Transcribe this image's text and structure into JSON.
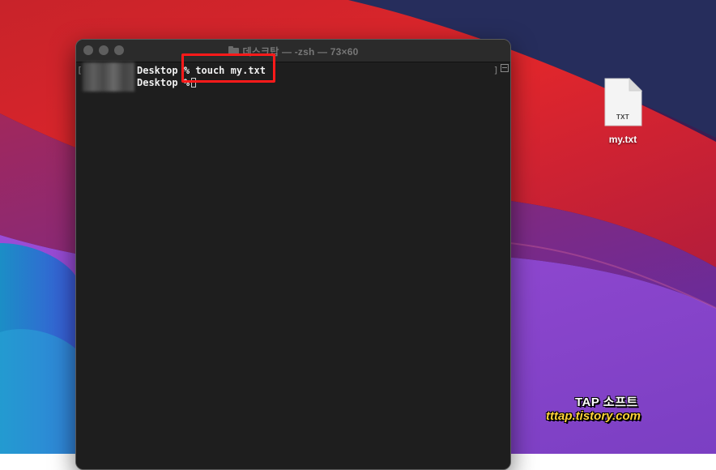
{
  "colors": {
    "highlight": "#ff1a1a",
    "terminal_bg": "#1e1e1e",
    "watermark_url": "#ffd23a"
  },
  "terminal": {
    "title": "데스크탑 — -zsh — 73×60",
    "lines": [
      {
        "prompt": "Desktop",
        "symbol": "%",
        "command": "touch my.txt"
      },
      {
        "prompt": "Desktop",
        "symbol": "%",
        "command": ""
      }
    ],
    "icons": [
      "close-button",
      "minimize-button",
      "zoom-button",
      "folder-icon",
      "cursor-block",
      "scroll-box-icon"
    ]
  },
  "desktop": {
    "file": {
      "type_tag": "TXT",
      "name": "my.txt",
      "icon": "txt-file-icon"
    }
  },
  "watermark": {
    "line1": "TAP 소프트",
    "line2": "tttap.tistory.com"
  }
}
